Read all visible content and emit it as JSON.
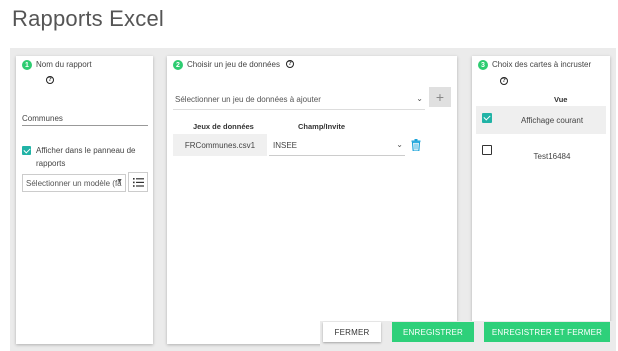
{
  "page": {
    "title": "Rapports Excel"
  },
  "report_name": {
    "step": "1",
    "label": "Nom du rapport",
    "value": "Communes",
    "show_in_panel_label": "Afficher dans le panneau de rapports",
    "show_in_panel_checked": true,
    "model_select": "Sélectionner un modèle (fa",
    "icons": {
      "help": "help-icon",
      "list": "list-icon",
      "chevron": "chevron-down-icon"
    }
  },
  "dataset": {
    "step": "2",
    "label": "Choisir un jeu de données",
    "select_placeholder": "Sélectionner un jeu de données à ajouter",
    "add_label": "+",
    "columns": [
      "Jeux de données",
      "Champ/Invite"
    ],
    "rows": [
      {
        "file": "FRCommunes.csv1",
        "field": "INSEE"
      }
    ],
    "icons": {
      "delete": "trash-icon"
    }
  },
  "maps": {
    "step": "3",
    "label": "Choix des cartes à incruster",
    "column": "Vue",
    "rows": [
      {
        "label": "Affichage courant",
        "checked": true
      },
      {
        "label": "Test16484",
        "checked": false
      }
    ]
  },
  "footer": {
    "close_label": "FERMER",
    "save_label": "ENREGISTRER",
    "save_close_label": "ENREGISTRER ET FERMER"
  },
  "colors": {
    "accent": "#2ed07a",
    "checkbox": "#21b3a6",
    "trash": "#1aa3d9"
  }
}
